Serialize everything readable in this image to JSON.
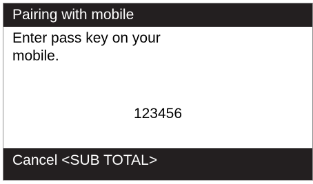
{
  "screen": {
    "title": "Pairing with mobile",
    "message_lines": [
      "Enter pass key on your",
      "mobile."
    ],
    "pass_key": "123456",
    "softkey": "Cancel <SUB TOTAL>"
  },
  "colors": {
    "bar_background": "#231f20",
    "bar_text": "#ffffff",
    "body_background": "#ffffff",
    "body_text": "#000000"
  }
}
